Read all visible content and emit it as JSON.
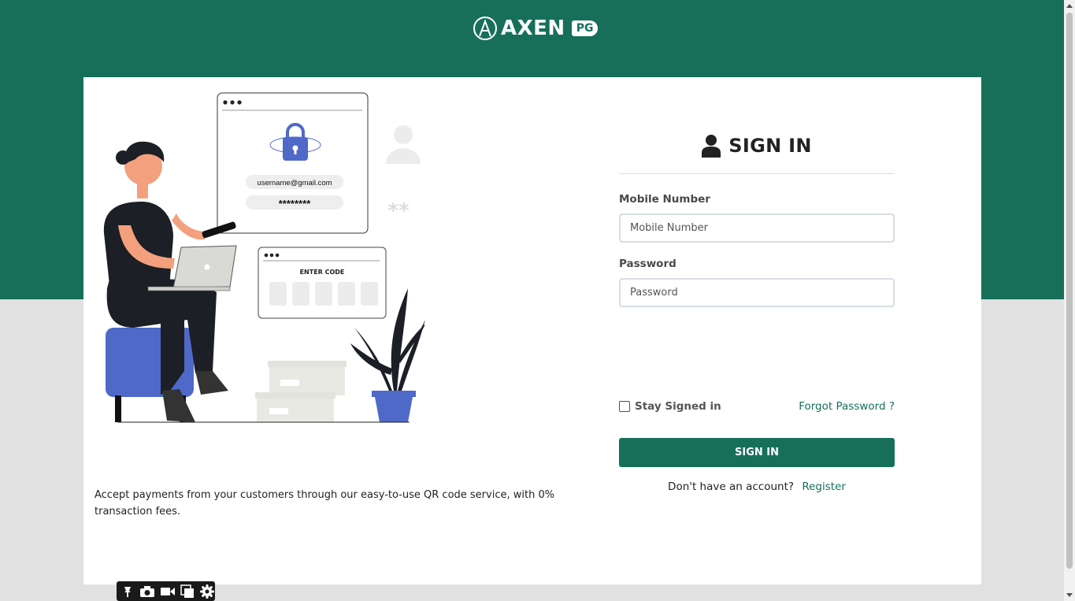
{
  "brand": {
    "name": "AXEN",
    "badge": "PG",
    "colors": {
      "primary": "#176f5a",
      "background_lower": "#e1e1e1"
    }
  },
  "illustration": {
    "email_example": "username@gmail.com",
    "password_mask": "********",
    "code_label": "ENTER CODE",
    "asterisks": "**"
  },
  "tagline": "Accept payments from your customers through our easy-to-use QR code service, with 0% transaction fees.",
  "form": {
    "title": "SIGN IN",
    "mobile": {
      "label": "Mobile Number",
      "placeholder": "Mobile Number",
      "value": ""
    },
    "password": {
      "label": "Password",
      "placeholder": "Password",
      "value": ""
    },
    "stay_signed_in": {
      "label": "Stay Signed in",
      "checked": false
    },
    "forgot_password": "Forgot Password ?",
    "submit_label": "SIGN IN",
    "register_prompt": "Don't have an account?",
    "register_link": "Register"
  },
  "toolbar": {
    "icons": [
      "pin-icon",
      "camera-icon",
      "video-icon",
      "copy-icon",
      "gear-icon"
    ]
  }
}
